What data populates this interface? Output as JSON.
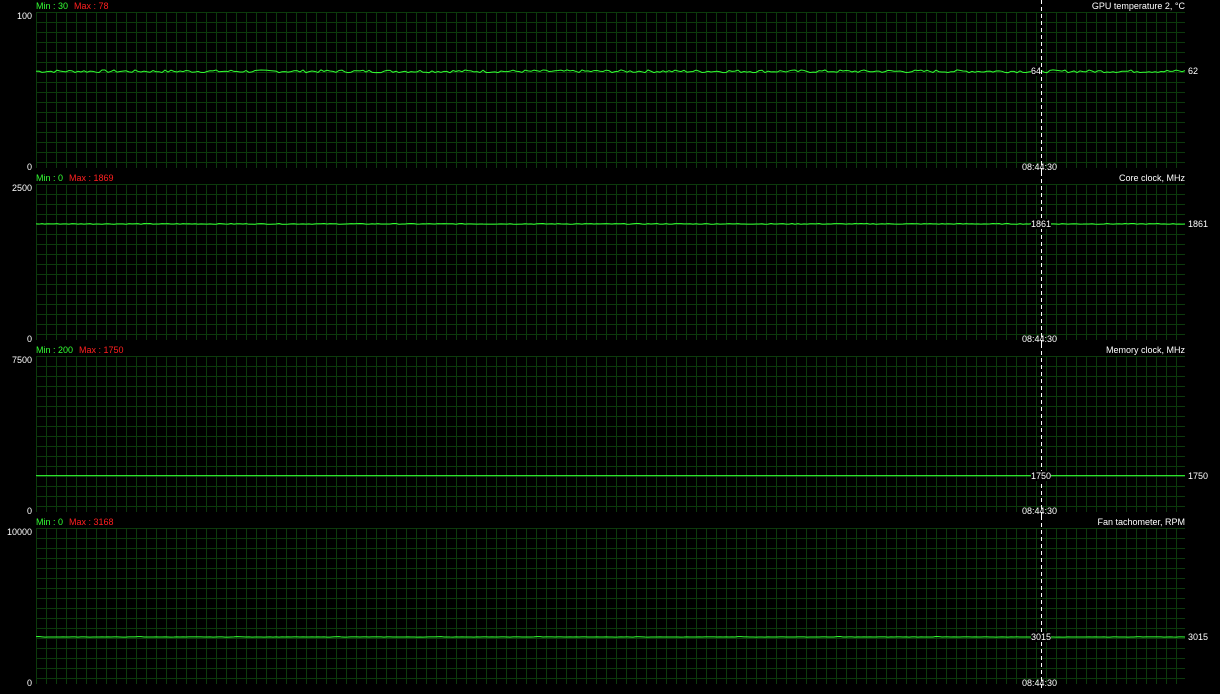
{
  "colors": {
    "background": "#000000",
    "grid": "#0c3a0c",
    "trace": "#33ff33",
    "min_text": "#33ff33",
    "max_text": "#ff2020",
    "cursor": "#ffffff"
  },
  "cursor_time": "08:44:30",
  "panels": [
    {
      "title": "GPU temperature 2, °C",
      "min_text": "Min : 30",
      "max_text": "Max : 78",
      "y_max": "100",
      "y_min": "0",
      "y_range": [
        0,
        100
      ],
      "cursor_value": "64",
      "current_value": "62",
      "level": 62,
      "noise": 0.9
    },
    {
      "title": "Core clock, MHz",
      "min_text": "Min : 0",
      "max_text": "Max : 1869",
      "y_max": "2500",
      "y_min": "0",
      "y_range": [
        0,
        2500
      ],
      "cursor_value": "1861",
      "current_value": "1861",
      "level": 1861,
      "noise": 6
    },
    {
      "title": "Memory clock, MHz",
      "min_text": "Min : 200",
      "max_text": "Max : 1750",
      "y_max": "7500",
      "y_min": "0",
      "y_range": [
        0,
        7500
      ],
      "cursor_value": "1750",
      "current_value": "1750",
      "level": 1750,
      "noise": 0
    },
    {
      "title": "Fan tachometer, RPM",
      "min_text": "Min : 0",
      "max_text": "Max : 3168",
      "y_max": "10000",
      "y_min": "0",
      "y_range": [
        0,
        10000
      ],
      "cursor_value": "3015",
      "current_value": "3015",
      "level": 3015,
      "noise": 8
    }
  ]
}
